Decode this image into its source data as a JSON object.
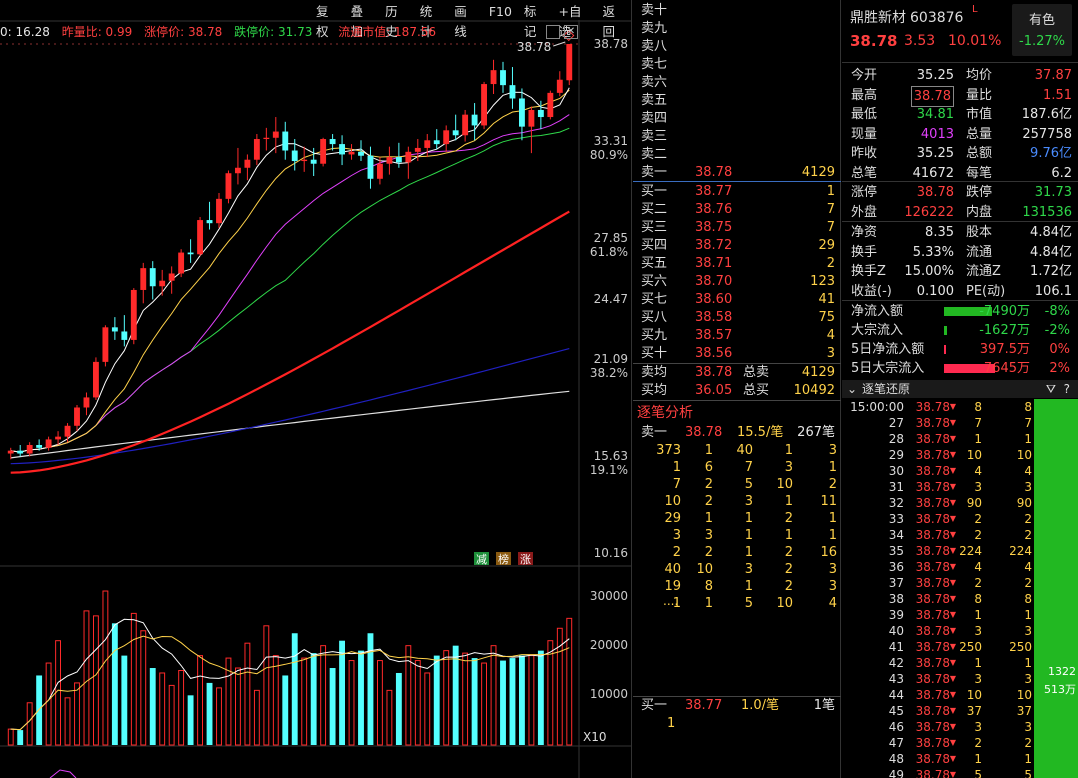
{
  "toolbar": [
    "复权",
    "叠加",
    "历史",
    "统计",
    "画线",
    "F10",
    "标记",
    "+自选",
    "返回"
  ],
  "info_bar": {
    "close_label": "0: 16.28",
    "vol_ratio": "昨量比: 0.99",
    "limit_up": "涨停价: 38.78",
    "limit_down": "跌停价: 31.73",
    "float_cap": "流通市值: 187.56"
  },
  "axis_labels": {
    "y": [
      "38.78",
      "33.31",
      "80.9%",
      "27.85",
      "61.8%",
      "24.47",
      "21.09",
      "38.2%",
      "15.63",
      "19.1%",
      "10.16"
    ],
    "vol": [
      "30000",
      "20000",
      "10000"
    ],
    "x10": "X10",
    "max_marker": "38.78"
  },
  "signals": [
    "减",
    "榜",
    "涨"
  ],
  "colors": {
    "up": "#ff2a2a",
    "down": "#54ffff",
    "ma5": "#ffffff",
    "ma10": "#ffd24a",
    "ma20": "#e040fb",
    "ma30": "#2fd84a",
    "ma60": "#ff2222",
    "ma120": "#2020c0",
    "ma250": "#e0e0e0"
  },
  "order_book": {
    "asks": [
      {
        "label": "卖十",
        "price": "",
        "vol": ""
      },
      {
        "label": "卖九",
        "price": "",
        "vol": ""
      },
      {
        "label": "卖八",
        "price": "",
        "vol": ""
      },
      {
        "label": "卖七",
        "price": "",
        "vol": ""
      },
      {
        "label": "卖六",
        "price": "",
        "vol": ""
      },
      {
        "label": "卖五",
        "price": "",
        "vol": ""
      },
      {
        "label": "卖四",
        "price": "",
        "vol": ""
      },
      {
        "label": "卖三",
        "price": "",
        "vol": ""
      },
      {
        "label": "卖二",
        "price": "",
        "vol": ""
      },
      {
        "label": "卖一",
        "price": "38.78",
        "vol": "4129"
      }
    ],
    "bids": [
      {
        "label": "买一",
        "price": "38.77",
        "vol": "1"
      },
      {
        "label": "买二",
        "price": "38.76",
        "vol": "7"
      },
      {
        "label": "买三",
        "price": "38.75",
        "vol": "7"
      },
      {
        "label": "买四",
        "price": "38.72",
        "vol": "29"
      },
      {
        "label": "买五",
        "price": "38.71",
        "vol": "2"
      },
      {
        "label": "买六",
        "price": "38.70",
        "vol": "123"
      },
      {
        "label": "买七",
        "price": "38.60",
        "vol": "41"
      },
      {
        "label": "买八",
        "price": "38.58",
        "vol": "75"
      },
      {
        "label": "买九",
        "price": "38.57",
        "vol": "4"
      },
      {
        "label": "买十",
        "price": "38.56",
        "vol": "3"
      }
    ],
    "avg_sell": {
      "label": "卖均",
      "price": "38.78",
      "tlabel": "总卖",
      "total": "4129"
    },
    "avg_buy": {
      "label": "买均",
      "price": "36.05",
      "tlabel": "总买",
      "total": "10492"
    }
  },
  "tick_analysis": {
    "title": "逐笔分析",
    "head": {
      "label": "卖一",
      "price": "38.78",
      "rate": "15.5/笔",
      "count": "267笔"
    },
    "rows": [
      [
        "373",
        "1",
        "40",
        "1",
        "3"
      ],
      [
        "1",
        "6",
        "7",
        "3",
        "1"
      ],
      [
        "7",
        "2",
        "5",
        "10",
        "2"
      ],
      [
        "10",
        "2",
        "3",
        "1",
        "11"
      ],
      [
        "29",
        "1",
        "1",
        "2",
        "1"
      ],
      [
        "3",
        "3",
        "1",
        "1",
        "1"
      ],
      [
        "2",
        "2",
        "1",
        "2",
        "16"
      ],
      [
        "40",
        "10",
        "3",
        "2",
        "3"
      ],
      [
        "19",
        "8",
        "1",
        "2",
        "3"
      ],
      [
        "1",
        "1",
        "5",
        "10",
        "4"
      ]
    ],
    "more": "....",
    "foot": {
      "label": "买一",
      "price": "38.77",
      "rate": "1.0/笔",
      "count": "1笔",
      "first": "1"
    }
  },
  "quote": {
    "name": "鼎胜新材",
    "code": "603876",
    "flag": "L",
    "badge_title": "有色",
    "badge_value": "-1.27%",
    "price": "38.78",
    "change": "3.53",
    "pct": "10.01%",
    "rows1": [
      {
        "l1": "今开",
        "v1": "35.25",
        "c1": "white",
        "l2": "均价",
        "v2": "37.87",
        "c2": "red"
      },
      {
        "l1": "最高",
        "v1": "38.78",
        "c1": "red",
        "b1": true,
        "l2": "量比",
        "v2": "1.51",
        "c2": "red"
      },
      {
        "l1": "最低",
        "v1": "34.81",
        "c1": "green",
        "l2": "市值",
        "v2": "187.6亿",
        "c2": "white"
      },
      {
        "l1": "现量",
        "v1": "4013",
        "c1": "purple",
        "l2": "总量",
        "v2": "257758",
        "c2": "white"
      },
      {
        "l1": "昨收",
        "v1": "35.25",
        "c1": "white",
        "l2": "总额",
        "v2": "9.76亿",
        "c2": "blue"
      },
      {
        "l1": "总笔",
        "v1": "41672",
        "c1": "white",
        "l2": "每笔",
        "v2": "6.2",
        "c2": "white"
      }
    ],
    "rows2": [
      {
        "l1": "涨停",
        "v1": "38.78",
        "c1": "red",
        "l2": "跌停",
        "v2": "31.73",
        "c2": "green"
      },
      {
        "l1": "外盘",
        "v1": "126222",
        "c1": "red",
        "l2": "内盘",
        "v2": "131536",
        "c2": "green"
      }
    ],
    "rows3": [
      {
        "l1": "净资",
        "v1": "8.35",
        "c1": "white",
        "l2": "股本",
        "v2": "4.84亿",
        "c2": "white"
      },
      {
        "l1": "换手",
        "v1": "5.33%",
        "c1": "white",
        "l2": "流通",
        "v2": "4.84亿",
        "c2": "white"
      },
      {
        "l1": "换手Z",
        "v1": "15.00%",
        "c1": "white",
        "l2": "流通Z",
        "v2": "1.72亿",
        "c2": "white"
      },
      {
        "l1": "收益(-)",
        "v1": "0.100",
        "c1": "white",
        "l2": "PE(动)",
        "v2": "106.1",
        "c2": "white"
      }
    ],
    "flows": [
      {
        "label": "净流入额",
        "value": "-7490万",
        "pct": "-8%",
        "color": "green",
        "bar": 0.8
      },
      {
        "label": "大宗流入",
        "value": "-1627万",
        "pct": "-2%",
        "color": "green",
        "bar": 0.05
      },
      {
        "label": "5日净流入额",
        "value": "397.5万",
        "pct": "0%",
        "color": "red",
        "bar": 0.02
      },
      {
        "label": "5日大宗流入",
        "value": "7645万",
        "pct": "2%",
        "color": "red",
        "bar": 0.85
      }
    ]
  },
  "time_sales": {
    "title": "逐笔还原",
    "rows": [
      [
        "15:00:00",
        "38.78",
        "8",
        "8"
      ],
      [
        "27",
        "38.78",
        "7",
        "7"
      ],
      [
        "28",
        "38.78",
        "1",
        "1"
      ],
      [
        "29",
        "38.78",
        "10",
        "10"
      ],
      [
        "30",
        "38.78",
        "4",
        "4"
      ],
      [
        "31",
        "38.78",
        "3",
        "3"
      ],
      [
        "32",
        "38.78",
        "90",
        "90"
      ],
      [
        "33",
        "38.78",
        "2",
        "2"
      ],
      [
        "34",
        "38.78",
        "2",
        "2"
      ],
      [
        "35",
        "38.78",
        "224",
        "224"
      ],
      [
        "36",
        "38.78",
        "4",
        "4"
      ],
      [
        "37",
        "38.78",
        "2",
        "2"
      ],
      [
        "38",
        "38.78",
        "8",
        "8"
      ],
      [
        "39",
        "38.78",
        "1",
        "1"
      ],
      [
        "40",
        "38.78",
        "3",
        "3"
      ],
      [
        "41",
        "38.78",
        "250",
        "250"
      ],
      [
        "42",
        "38.78",
        "1",
        "1"
      ],
      [
        "43",
        "38.78",
        "3",
        "3"
      ],
      [
        "44",
        "38.78",
        "10",
        "10"
      ],
      [
        "45",
        "38.78",
        "37",
        "37"
      ],
      [
        "46",
        "38.78",
        "3",
        "3"
      ],
      [
        "47",
        "38.78",
        "2",
        "2"
      ],
      [
        "48",
        "38.78",
        "1",
        "1"
      ],
      [
        "49",
        "38.78",
        "5",
        "5"
      ]
    ],
    "bar_v1": "1322",
    "bar_v2": "513万"
  },
  "chart_data": {
    "type": "candlestick",
    "ylim": [
      10.16,
      38.78
    ],
    "log_scale": true,
    "candles": [
      [
        13.2,
        13.4,
        13.0,
        13.3
      ],
      [
        13.3,
        13.5,
        13.1,
        13.2
      ],
      [
        13.2,
        13.6,
        13.1,
        13.5
      ],
      [
        13.5,
        13.7,
        13.3,
        13.4
      ],
      [
        13.4,
        13.8,
        13.3,
        13.7
      ],
      [
        13.7,
        14.0,
        13.5,
        13.8
      ],
      [
        13.8,
        14.3,
        13.6,
        14.2
      ],
      [
        14.2,
        15.0,
        14.0,
        14.9
      ],
      [
        14.9,
        15.5,
        14.6,
        15.3
      ],
      [
        15.3,
        17.0,
        15.2,
        16.8
      ],
      [
        16.8,
        18.5,
        16.6,
        18.4
      ],
      [
        18.4,
        18.9,
        17.8,
        18.2
      ],
      [
        18.2,
        19.0,
        17.5,
        17.8
      ],
      [
        17.8,
        20.4,
        17.6,
        20.3
      ],
      [
        20.3,
        21.8,
        19.6,
        21.5
      ],
      [
        21.5,
        21.9,
        19.8,
        20.5
      ],
      [
        20.5,
        21.4,
        20.0,
        20.8
      ],
      [
        20.8,
        21.6,
        20.1,
        21.2
      ],
      [
        21.2,
        22.6,
        21.0,
        22.4
      ],
      [
        22.4,
        23.2,
        21.8,
        22.3
      ],
      [
        22.3,
        24.6,
        22.2,
        24.4
      ],
      [
        24.4,
        25.6,
        23.8,
        24.2
      ],
      [
        24.2,
        26.2,
        23.9,
        25.8
      ],
      [
        25.8,
        27.8,
        25.5,
        27.6
      ],
      [
        27.6,
        29.5,
        26.8,
        28.0
      ],
      [
        28.0,
        29.0,
        27.1,
        28.6
      ],
      [
        28.6,
        30.6,
        28.2,
        30.2
      ],
      [
        30.2,
        31.1,
        29.3,
        30.3
      ],
      [
        30.3,
        32.0,
        29.1,
        30.8
      ],
      [
        30.8,
        31.6,
        28.6,
        29.3
      ],
      [
        29.3,
        30.2,
        27.8,
        28.5
      ],
      [
        28.5,
        29.6,
        27.7,
        28.6
      ],
      [
        28.6,
        29.5,
        27.4,
        28.3
      ],
      [
        28.3,
        30.3,
        28.1,
        30.2
      ],
      [
        30.2,
        30.6,
        29.3,
        29.8
      ],
      [
        29.8,
        30.5,
        28.2,
        29.0
      ],
      [
        29.0,
        29.8,
        28.6,
        29.2
      ],
      [
        29.2,
        30.1,
        28.5,
        28.9
      ],
      [
        28.9,
        29.6,
        26.5,
        27.2
      ],
      [
        27.2,
        28.8,
        26.8,
        28.3
      ],
      [
        28.3,
        29.6,
        27.5,
        28.8
      ],
      [
        28.8,
        29.9,
        28.0,
        28.4
      ],
      [
        28.4,
        29.6,
        27.2,
        29.2
      ],
      [
        29.2,
        30.2,
        28.5,
        29.5
      ],
      [
        29.5,
        30.6,
        28.8,
        30.1
      ],
      [
        30.1,
        31.0,
        29.4,
        29.8
      ],
      [
        29.8,
        31.3,
        29.2,
        30.9
      ],
      [
        30.9,
        32.2,
        30.1,
        30.5
      ],
      [
        30.5,
        32.6,
        30.0,
        32.2
      ],
      [
        32.2,
        33.2,
        30.1,
        31.3
      ],
      [
        31.3,
        35.1,
        31.0,
        34.9
      ],
      [
        34.9,
        37.2,
        34.0,
        36.2
      ],
      [
        36.2,
        37.0,
        34.1,
        34.8
      ],
      [
        34.8,
        36.5,
        32.7,
        33.6
      ],
      [
        33.6,
        34.5,
        30.1,
        31.2
      ],
      [
        31.2,
        32.9,
        29.1,
        32.6
      ],
      [
        32.6,
        33.4,
        31.0,
        32.0
      ],
      [
        32.0,
        34.3,
        31.8,
        34.1
      ],
      [
        34.1,
        36.1,
        33.8,
        35.3
      ],
      [
        35.25,
        38.78,
        34.81,
        38.78
      ]
    ],
    "volumes": [
      3200,
      3000,
      8500,
      14000,
      16500,
      21000,
      9500,
      12500,
      27000,
      26000,
      31000,
      24500,
      18000,
      26500,
      23000,
      15500,
      14500,
      12000,
      15000,
      10000,
      18000,
      12500,
      11500,
      17500,
      15500,
      20500,
      11000,
      24000,
      18000,
      14000,
      22500,
      17500,
      18500,
      20000,
      15500,
      21000,
      17000,
      19000,
      22500,
      17000,
      11000,
      14500,
      20000,
      17000,
      14500,
      18000,
      19000,
      20000,
      18500,
      17500,
      16500,
      20000,
      17000,
      17500,
      18000,
      18000,
      19000,
      21000,
      23500,
      25500
    ]
  }
}
